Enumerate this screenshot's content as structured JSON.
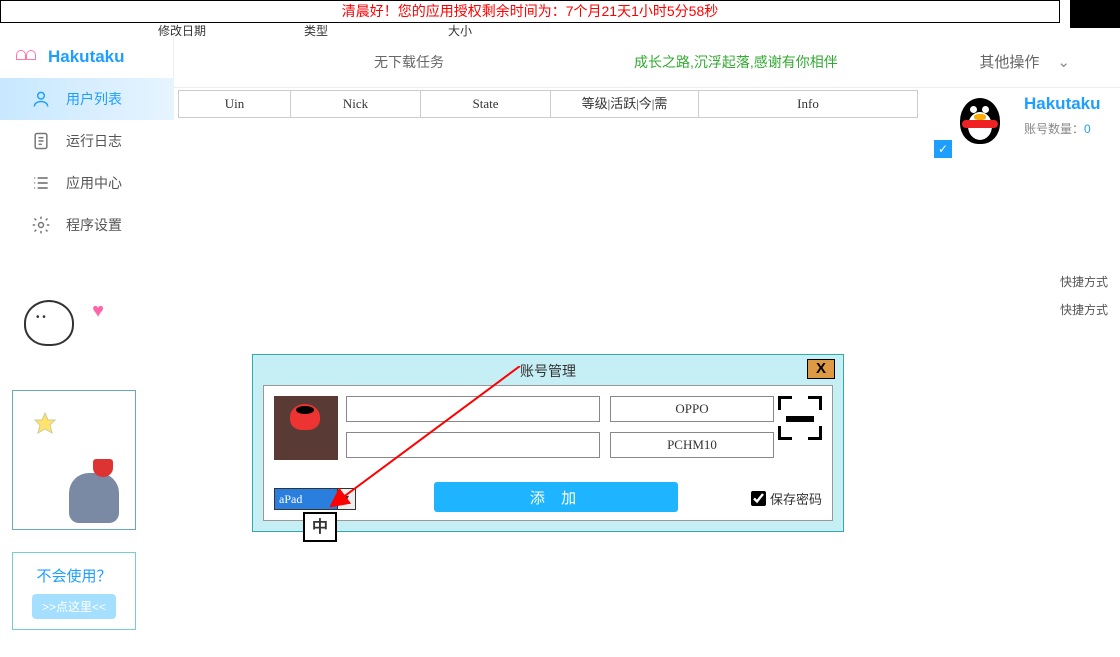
{
  "banner": "清晨好！您的应用授权剩余时间为：7个月21天1小时5分58秒",
  "small_cols": {
    "c1": "修改日期",
    "c2": "类型",
    "c3": "大小"
  },
  "brand": "Hakutaku",
  "nav": {
    "users": "用户列表",
    "logs": "运行日志",
    "apps": "应用中心",
    "settings": "程序设置"
  },
  "help": {
    "question": "不会使用？",
    "button": ">>点这里<<"
  },
  "header": {
    "center": "无下载任务",
    "green": "成长之路,沉浮起落,感谢有你相伴",
    "ops": "其他操作"
  },
  "table": {
    "uin": "Uin",
    "nick": "Nick",
    "state": "State",
    "misc": "等级|活跃|今|需",
    "info": "Info"
  },
  "right": {
    "title": "Hakutaku",
    "count_label": "账号数量：",
    "count_value": "0",
    "l1": "快捷方式",
    "l2": "快捷方式"
  },
  "modal": {
    "title": "账号管理",
    "brand": "OPPO",
    "model": "PCHM10",
    "device": "aPad",
    "add": "添 加",
    "save_pw": "保存密码"
  },
  "ime": "中"
}
